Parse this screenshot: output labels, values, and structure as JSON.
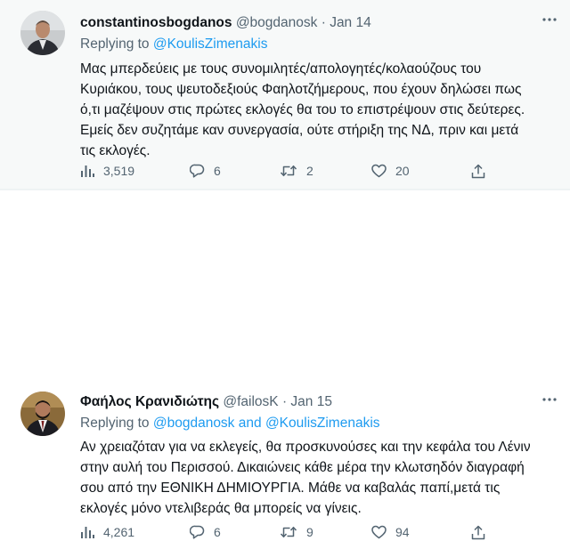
{
  "tweets": [
    {
      "name": "constantinosbogdanos",
      "handle": "@bogdanosk",
      "separator": "·",
      "date": "Jan 14",
      "replying_prefix": "Replying to",
      "replying_to": "@KoulisZimenakis",
      "reply_and": "",
      "replying_to_2": "",
      "body_lines": [
        "Μας μπερδεύεις με τους συνομιλητές/απολογητές/κολαούζους του",
        "Κυριάκου, τους ψευτοδεξιούς Φαηλοτζήμερους, που έχουν δηλώσει πως",
        "ό,τι μαζέψουν στις πρώτες εκλογές θα του το επιστρέψουν στις δεύτερες.",
        "Εμείς δεν συζητάμε καν συνεργασία, ούτε στήριξη της ΝΔ, πριν και μετά",
        "τις εκλογές."
      ],
      "views": "3,519",
      "replies": "6",
      "retweets": "2",
      "likes": "20"
    },
    {
      "name": "Φαήλος Κρανιδιώτης",
      "handle": "@failosK",
      "separator": "·",
      "date": "Jan 15",
      "replying_prefix": "Replying to",
      "replying_to": "@bogdanosk",
      "reply_and": "and",
      "replying_to_2": "@KoulisZimenakis",
      "body_lines": [
        "Αν χρειαζόταν για να εκλεγείς, θα προσκυνούσες και την κεφάλα του Λένιν",
        "στην αυλή του Περισσού. Δικαιώνεις κάθε μέρα την κλωτσηδόν διαγραφή",
        "σου από την ΕΘΝΙΚΗ ΔΗΜΙΟΥΡΓΙΑ. Μάθε να καβαλάς παπί,μετά τις",
        "εκλογές μόνο ντελιβεράς θα μπορείς να γίνεις."
      ],
      "views": "4,261",
      "replies": "6",
      "retweets": "9",
      "likes": "94"
    }
  ],
  "icons": {
    "views": "analytics-icon",
    "reply": "reply-icon",
    "retweet": "retweet-icon",
    "like": "heart-icon",
    "share": "share-icon",
    "more": "more-icon"
  },
  "colors": {
    "text": "#0f1419",
    "secondary": "#536471",
    "accent": "#1d9bf0",
    "highlight_bg": "#f7f9f9"
  }
}
